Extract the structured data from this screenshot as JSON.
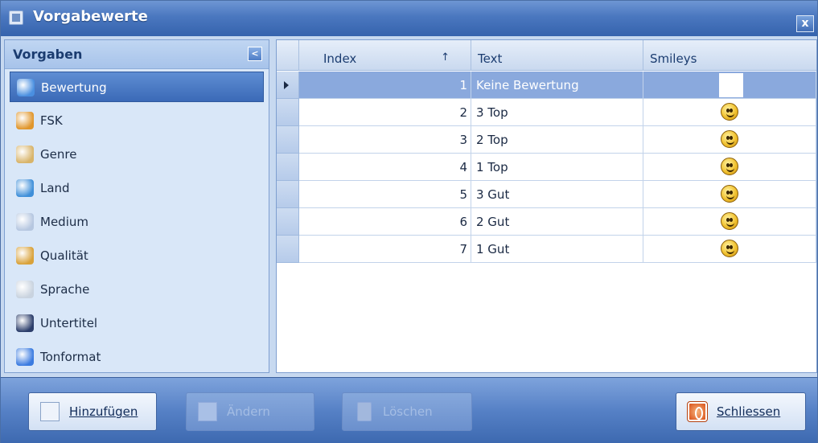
{
  "window": {
    "title": "Vorgabewerte",
    "close_label": "x"
  },
  "sidebar": {
    "header": "Vorgaben",
    "collapse_label": "<",
    "items": [
      {
        "label": "Bewertung",
        "icon": "rating-icon",
        "color": "#4a8fe0",
        "selected": true
      },
      {
        "label": "FSK",
        "icon": "age-rating-icon",
        "color": "#e0962c",
        "selected": false
      },
      {
        "label": "Genre",
        "icon": "film-strip-icon",
        "color": "#d8b46a",
        "selected": false
      },
      {
        "label": "Land",
        "icon": "globe-icon",
        "color": "#3f8fd9",
        "selected": false
      },
      {
        "label": "Medium",
        "icon": "disc-icon",
        "color": "#b6c7e0",
        "selected": false
      },
      {
        "label": "Qualität",
        "icon": "tools-icon",
        "color": "#d9a23a",
        "selected": false
      },
      {
        "label": "Sprache",
        "icon": "speech-bubble-icon",
        "color": "#c9d3df",
        "selected": false
      },
      {
        "label": "Untertitel",
        "icon": "subtitle-letters-icon",
        "color": "#2c3e6b",
        "selected": false
      },
      {
        "label": "Tonformat",
        "icon": "music-note-icon",
        "color": "#3b7be0",
        "selected": false
      }
    ]
  },
  "grid": {
    "columns": {
      "index": "Index",
      "sort_indicator": "↑",
      "text": "Text",
      "smileys": "Smileys"
    },
    "rows": [
      {
        "index": "1",
        "text": "Keine Bewertung",
        "smiley": null,
        "selected": true
      },
      {
        "index": "2",
        "text": "3 Top",
        "smiley": "smiley-3-top",
        "selected": false
      },
      {
        "index": "3",
        "text": "2 Top",
        "smiley": "smiley-2-top",
        "selected": false
      },
      {
        "index": "4",
        "text": "1 Top",
        "smiley": "smiley-1-top",
        "selected": false
      },
      {
        "index": "5",
        "text": "3 Gut",
        "smiley": "smiley-3-gut",
        "selected": false
      },
      {
        "index": "6",
        "text": "2 Gut",
        "smiley": "smiley-2-gut",
        "selected": false
      },
      {
        "index": "7",
        "text": "1 Gut",
        "smiley": "smiley-1-gut",
        "selected": false
      }
    ]
  },
  "toolbar": {
    "add_label": "Hinzufügen",
    "edit_label": "Ändern",
    "delete_label": "Löschen",
    "close_label": "Schliessen"
  }
}
